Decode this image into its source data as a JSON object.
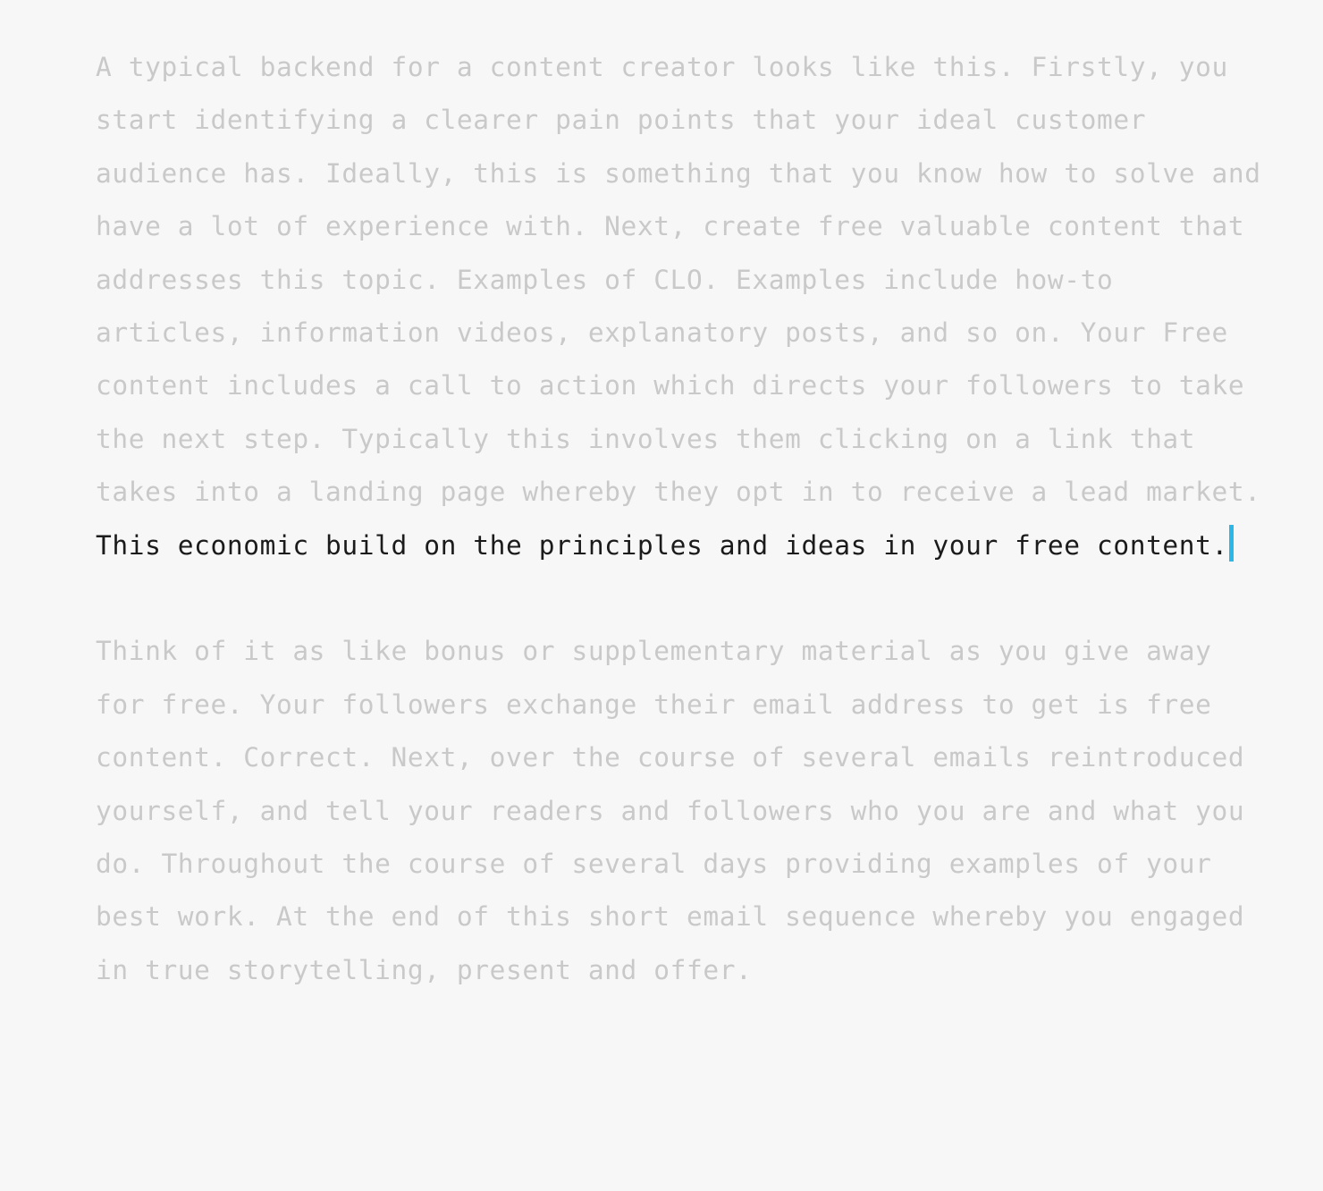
{
  "document": {
    "background_color": "#f7f7f7",
    "muted_text_color": "#c9c9c9",
    "committed_text_color": "#1b1b1b",
    "caret_color": "#2bb8e8",
    "paragraphs": [
      {
        "id": "paragraph-1",
        "muted_prefix": "A typical backend for a content creator looks like this. Firstly, you start identifying a clearer pain points that your ideal customer audience has. Ideally, this is something that you know how to solve and have a lot of experience with. Next, create free valuable content that addresses this topic. Examples of CLO. Examples include how-to articles, information videos, explanatory posts, and so on. Your Free content includes a call to action which directs your followers to take the next step. Typically this involves them clicking on a link that takes into a landing page whereby they opt in to receive a lead market. ",
        "committed_text": "This economic build on the principles and ideas in your free content.",
        "has_caret": true
      },
      {
        "id": "paragraph-2",
        "muted_prefix": "Think of it as like bonus or supplementary material as you give away for free. Your followers exchange their email address to get is free content. Correct. Next, over the course of several emails reintroduced yourself, and tell your readers and followers who you are and what you do. Throughout the course of several days providing examples of your best work. At the end of this short email sequence whereby you engaged in true storytelling, present and offer.",
        "committed_text": "",
        "has_caret": false
      }
    ]
  }
}
